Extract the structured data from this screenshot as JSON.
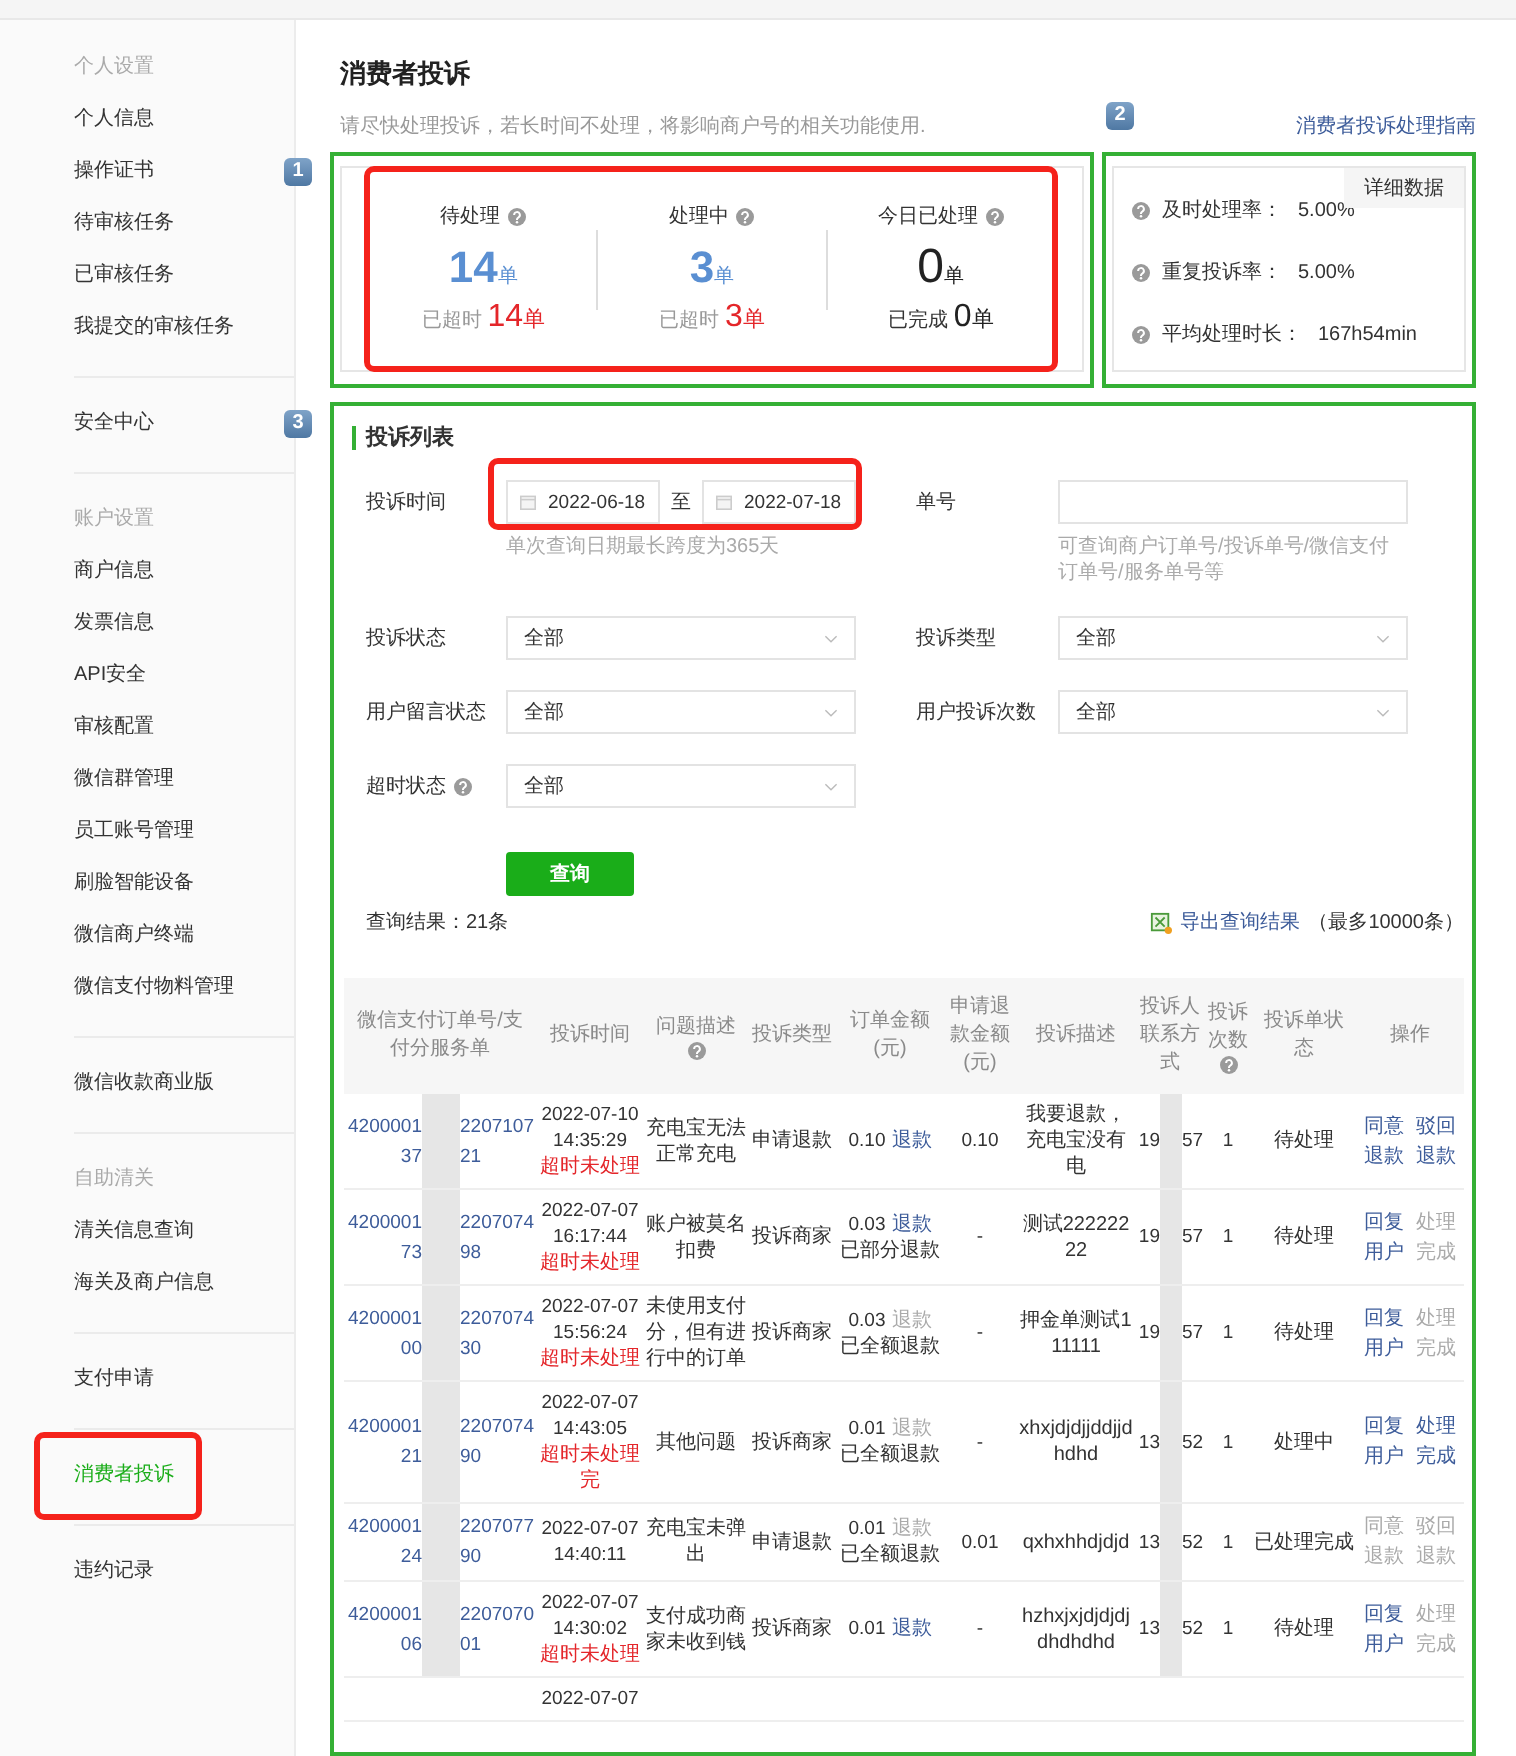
{
  "sidebar": {
    "groups": [
      {
        "title": "个人设置",
        "items": [
          {
            "label": "个人信息",
            "selected": false
          },
          {
            "label": "操作证书",
            "selected": false,
            "badge": "1"
          },
          {
            "label": "待审核任务",
            "selected": false
          },
          {
            "label": "已审核任务",
            "selected": false
          },
          {
            "label": "我提交的审核任务",
            "selected": false
          }
        ]
      },
      {
        "items": [
          {
            "label": "安全中心",
            "selected": false,
            "badge": "3"
          }
        ]
      },
      {
        "title": "账户设置",
        "items": [
          {
            "label": "商户信息",
            "selected": false
          },
          {
            "label": "发票信息",
            "selected": false
          },
          {
            "label": "API安全",
            "selected": false
          },
          {
            "label": "审核配置",
            "selected": false
          },
          {
            "label": "微信群管理",
            "selected": false
          },
          {
            "label": "员工账号管理",
            "selected": false
          },
          {
            "label": "刷脸智能设备",
            "selected": false
          },
          {
            "label": "微信商户终端",
            "selected": false
          },
          {
            "label": "微信支付物料管理",
            "selected": false
          }
        ]
      },
      {
        "items": [
          {
            "label": "微信收款商业版",
            "selected": false
          }
        ]
      },
      {
        "title": "自助清关",
        "items": [
          {
            "label": "清关信息查询",
            "selected": false
          },
          {
            "label": "海关及商户信息",
            "selected": false
          }
        ]
      },
      {
        "items": [
          {
            "label": "支付申请",
            "selected": false
          }
        ]
      },
      {
        "items": [
          {
            "label": "消费者投诉",
            "selected": true
          }
        ]
      },
      {
        "items": [
          {
            "label": "违约记录",
            "selected": false
          }
        ]
      }
    ]
  },
  "page": {
    "title": "消费者投诉",
    "subtitle": "请尽快处理投诉，若长时间不处理，将影响商户号的相关功能使用.",
    "guide_link": "消费者投诉处理指南"
  },
  "stats": [
    {
      "label": "待处理",
      "kind": "pending",
      "count": "14",
      "unit": "单",
      "footer_label": "已超时",
      "footer_value": "14",
      "footer_unit": "单"
    },
    {
      "label": "处理中",
      "kind": "pending",
      "count": "3",
      "unit": "单",
      "footer_label": "已超时",
      "footer_value": "3",
      "footer_unit": "单"
    },
    {
      "label": "今日已处理",
      "kind": "done",
      "count": "0",
      "unit": "单",
      "footer_label": "已完成",
      "footer_value": "0",
      "footer_unit": "单"
    }
  ],
  "rates": {
    "badge": "2",
    "detail_button": "详细数据",
    "items": [
      {
        "label": "及时处理率：",
        "value": "5.00%"
      },
      {
        "label": "重复投诉率：",
        "value": "5.00%"
      },
      {
        "label": "平均处理时长：",
        "value": "167h54min"
      }
    ]
  },
  "list": {
    "title": "投诉列表",
    "filters": [
      {
        "kind": "date_range",
        "label": "投诉时间",
        "from": "2022-06-18",
        "separator": "至",
        "to": "2022-07-18",
        "hint": "单次查询日期最长跨度为365天"
      },
      {
        "kind": "text",
        "label": "单号",
        "hint": "可查询商户订单号/投诉单号/微信支付订单号/服务单号等"
      },
      {
        "kind": "select",
        "label": "投诉状态",
        "value": "全部"
      },
      {
        "kind": "select",
        "label": "投诉类型",
        "value": "全部"
      },
      {
        "kind": "select",
        "label": "用户留言状态",
        "value": "全部"
      },
      {
        "kind": "select",
        "label": "用户投诉次数",
        "value": "全部"
      },
      {
        "kind": "select",
        "label": "超时状态",
        "value": "全部",
        "help": true
      }
    ],
    "query_button": "查询",
    "result_count": "查询结果：21条",
    "export_link": "导出查询结果",
    "export_note": "（最多10000条）",
    "columns": [
      {
        "label": "微信支付订单号/支付分服务单"
      },
      {
        "label": "投诉时间"
      },
      {
        "label": "问题描述",
        "help": true
      },
      {
        "label": "投诉类型"
      },
      {
        "label": "订单金额(元)"
      },
      {
        "label": "申请退款金额(元)"
      },
      {
        "label": "投诉描述"
      },
      {
        "label": "投诉人联系方式"
      },
      {
        "label": "投诉次数",
        "help": true
      },
      {
        "label": "投诉单状态"
      },
      {
        "label": "操作"
      }
    ],
    "rows": [
      {
        "order": {
          "head": [
            "4200001",
            "2207107"
          ],
          "tail": [
            "37",
            "21"
          ]
        },
        "time": "2022-07-10",
        "clock": "14:35:29",
        "overdue": "超时未处理",
        "issue": "充电宝无法正常充电",
        "type": "申请退款",
        "amount": "0.10",
        "refund": {
          "label": "退款",
          "enabled": true
        },
        "refund_amount": "0.10",
        "description": "我要退款，充电宝没有电",
        "contact": [
          "19",
          "57"
        ],
        "count": "1",
        "status": "待处理",
        "actions": [
          {
            "label": "同意退款",
            "enabled": true
          },
          {
            "label": "驳回退款",
            "enabled": true
          }
        ]
      },
      {
        "order": {
          "head": [
            "4200001",
            "2207074"
          ],
          "tail": [
            "73",
            "98"
          ]
        },
        "time": "2022-07-07",
        "clock": "16:17:44",
        "overdue": "超时未处理",
        "issue": "账户被莫名扣费",
        "type": "投诉商家",
        "amount": "0.03",
        "refund": {
          "label": "退款",
          "enabled": true
        },
        "refund_status": "已部分退款",
        "refund_amount": "-",
        "description": "测试22222222",
        "contact": [
          "19",
          "57"
        ],
        "count": "1",
        "status": "待处理",
        "actions": [
          {
            "label": "回复用户",
            "enabled": true
          },
          {
            "label": "处理完成",
            "enabled": false
          }
        ]
      },
      {
        "order": {
          "head": [
            "4200001",
            "2207074"
          ],
          "tail": [
            "00",
            "30"
          ]
        },
        "time": "2022-07-07",
        "clock": "15:56:24",
        "overdue": "超时未处理",
        "issue": "未使用支付分，但有进行中的订单",
        "type": "投诉商家",
        "amount": "0.03",
        "refund": {
          "label": "退款",
          "enabled": false
        },
        "refund_status": "已全额退款",
        "refund_amount": "-",
        "description": "押金单测试111111",
        "contact": [
          "19",
          "57"
        ],
        "count": "1",
        "status": "待处理",
        "actions": [
          {
            "label": "回复用户",
            "enabled": true
          },
          {
            "label": "处理完成",
            "enabled": false
          }
        ]
      },
      {
        "order": {
          "head": [
            "4200001",
            "2207074"
          ],
          "tail": [
            "21",
            "90"
          ]
        },
        "time": "2022-07-07",
        "clock": "14:43:05",
        "overdue": "超时未处理完",
        "issue": "其他问题",
        "type": "投诉商家",
        "amount": "0.01",
        "refund": {
          "label": "退款",
          "enabled": false
        },
        "refund_status": "已全额退款",
        "refund_amount": "-",
        "description": "xhxjdjdjjddjjdhdhd",
        "contact": [
          "13",
          "52"
        ],
        "count": "1",
        "status": "处理中",
        "actions": [
          {
            "label": "回复用户",
            "enabled": true
          },
          {
            "label": "处理完成",
            "enabled": true
          }
        ]
      },
      {
        "order": {
          "head": [
            "4200001",
            "2207077"
          ],
          "tail": [
            "24",
            "90"
          ]
        },
        "time": "2022-07-07",
        "clock": "14:40:11",
        "issue": "充电宝未弹出",
        "type": "申请退款",
        "amount": "0.01",
        "refund": {
          "label": "退款",
          "enabled": false
        },
        "refund_status": "已全额退款",
        "refund_amount": "0.01",
        "description": "qxhxhhdjdjd",
        "contact": [
          "13",
          "52"
        ],
        "count": "1",
        "status": "已处理完成",
        "actions": [
          {
            "label": "同意退款",
            "enabled": false
          },
          {
            "label": "驳回退款",
            "enabled": false
          }
        ]
      },
      {
        "order": {
          "head": [
            "4200001",
            "2207070"
          ],
          "tail": [
            "06",
            "01"
          ]
        },
        "time": "2022-07-07",
        "clock": "14:30:02",
        "overdue": "超时未处理",
        "issue": "支付成功商家未收到钱",
        "type": "投诉商家",
        "amount": "0.01",
        "refund": {
          "label": "退款",
          "enabled": true
        },
        "refund_amount": "-",
        "description": "hzhxjxjdjdjdjdhdhdhd",
        "contact": [
          "13",
          "52"
        ],
        "count": "1",
        "status": "待处理",
        "actions": [
          {
            "label": "回复用户",
            "enabled": true
          },
          {
            "label": "处理完成",
            "enabled": false
          }
        ]
      },
      {
        "time": "2022-07-07"
      }
    ]
  }
}
